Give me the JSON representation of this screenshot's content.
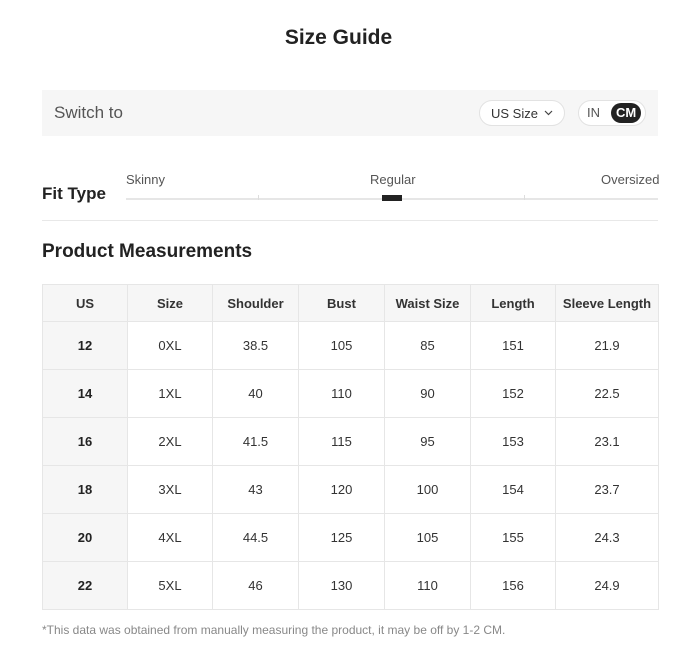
{
  "title": "Size Guide",
  "switch_bar": {
    "label": "Switch to",
    "size_select": "US Size",
    "units": [
      "IN",
      "CM"
    ],
    "active_unit": "CM"
  },
  "fit_type": {
    "label": "Fit Type",
    "scale": [
      "Skinny",
      "Regular",
      "Oversized"
    ],
    "selected": "Regular"
  },
  "measurements": {
    "title": "Product Measurements",
    "columns": [
      "US",
      "Size",
      "Shoulder",
      "Bust",
      "Waist Size",
      "Length",
      "Sleeve Length"
    ],
    "rows": [
      [
        "12",
        "0XL",
        "38.5",
        "105",
        "85",
        "151",
        "21.9"
      ],
      [
        "14",
        "1XL",
        "40",
        "110",
        "90",
        "152",
        "22.5"
      ],
      [
        "16",
        "2XL",
        "41.5",
        "115",
        "95",
        "153",
        "23.1"
      ],
      [
        "18",
        "3XL",
        "43",
        "120",
        "100",
        "154",
        "23.7"
      ],
      [
        "20",
        "4XL",
        "44.5",
        "125",
        "105",
        "155",
        "24.3"
      ],
      [
        "22",
        "5XL",
        "46",
        "130",
        "110",
        "156",
        "24.9"
      ]
    ]
  },
  "note": "*This data was obtained from manually measuring the product, it may be off by 1-2 CM."
}
